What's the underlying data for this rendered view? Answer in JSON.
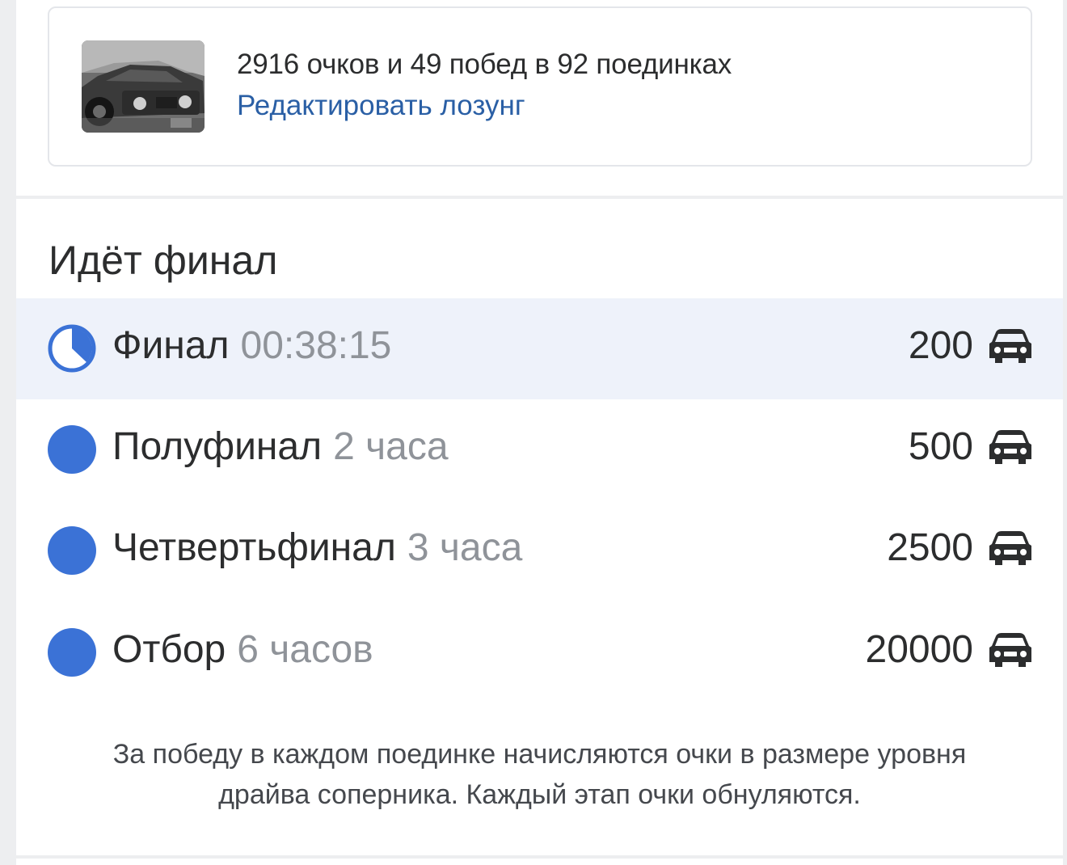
{
  "profile": {
    "stats": "2916 очков и 49 побед в 92 поединках",
    "edit_link": "Редактировать лозунг",
    "photo_icon": "car-photo"
  },
  "section": {
    "title": "Идёт финал"
  },
  "stages": [
    {
      "name": "Финал",
      "time": "00:38:15",
      "prize": "200",
      "status": "in-progress",
      "icon": "clock-icon"
    },
    {
      "name": "Полуфинал",
      "time": "2 часа",
      "prize": "500",
      "status": "upcoming",
      "icon": "dot-icon"
    },
    {
      "name": "Четвертьфинал",
      "time": "3 часа",
      "prize": "2500",
      "status": "upcoming",
      "icon": "dot-icon"
    },
    {
      "name": "Отбор",
      "time": "6 часов",
      "prize": "20000",
      "status": "upcoming",
      "icon": "dot-icon"
    }
  ],
  "footer": {
    "line1": "За победу в каждом поединке начисляются очки в размере уровня",
    "line2": "драйва соперника. Каждый этап очки обнуляются."
  },
  "colors": {
    "accent": "#3b72d6",
    "link": "#2a5fa5",
    "active_row": "#eef2fa",
    "muted_text": "#8f9399"
  }
}
